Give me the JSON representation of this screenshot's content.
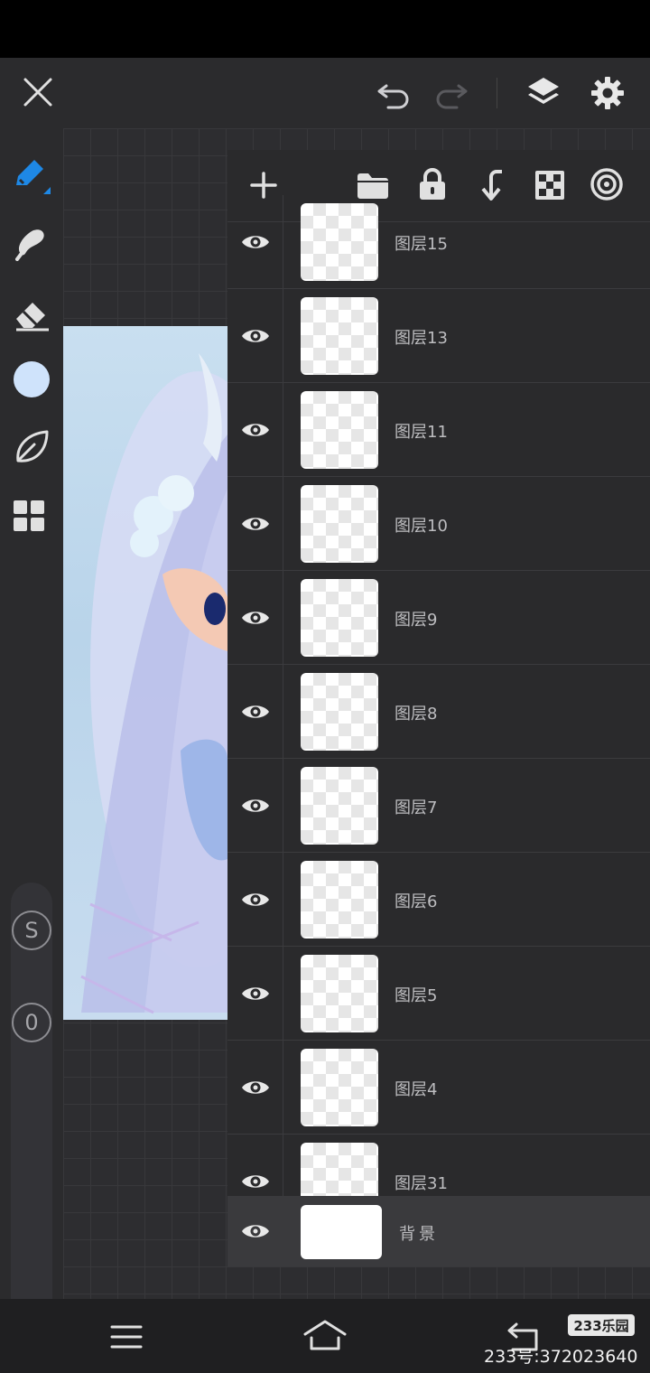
{
  "app": {
    "accent_color": "#1e88e5",
    "brush_color": "#cfe3fb"
  },
  "top_bar": {
    "icons": [
      "close-icon",
      "undo-icon",
      "redo-icon",
      "layers-icon",
      "settings-icon"
    ]
  },
  "left_toolbar": {
    "tools": [
      "pen-icon",
      "smudge-icon",
      "eraser-icon",
      "color-swatch",
      "leaf-icon",
      "grid-icon"
    ],
    "size_badge": "S",
    "opacity_badge": "0"
  },
  "layers_panel": {
    "toolbar_icons": [
      "add-layer-icon",
      "folder-icon",
      "lock-icon",
      "merge-down-icon",
      "transparency-icon",
      "target-icon"
    ],
    "layers": [
      {
        "name": "图层15"
      },
      {
        "name": "图层13"
      },
      {
        "name": "图层11"
      },
      {
        "name": "图层10"
      },
      {
        "name": "图层9"
      },
      {
        "name": "图层8"
      },
      {
        "name": "图层7"
      },
      {
        "name": "图层6"
      },
      {
        "name": "图层5"
      },
      {
        "name": "图层4"
      },
      {
        "name": "图层31"
      }
    ],
    "background_layer": {
      "name": "背景"
    }
  },
  "nav_bar": {
    "icons": [
      "menu-icon",
      "home-icon",
      "back-icon"
    ]
  },
  "watermark": {
    "logo": "233乐园",
    "id_text": "233号:372023640"
  }
}
